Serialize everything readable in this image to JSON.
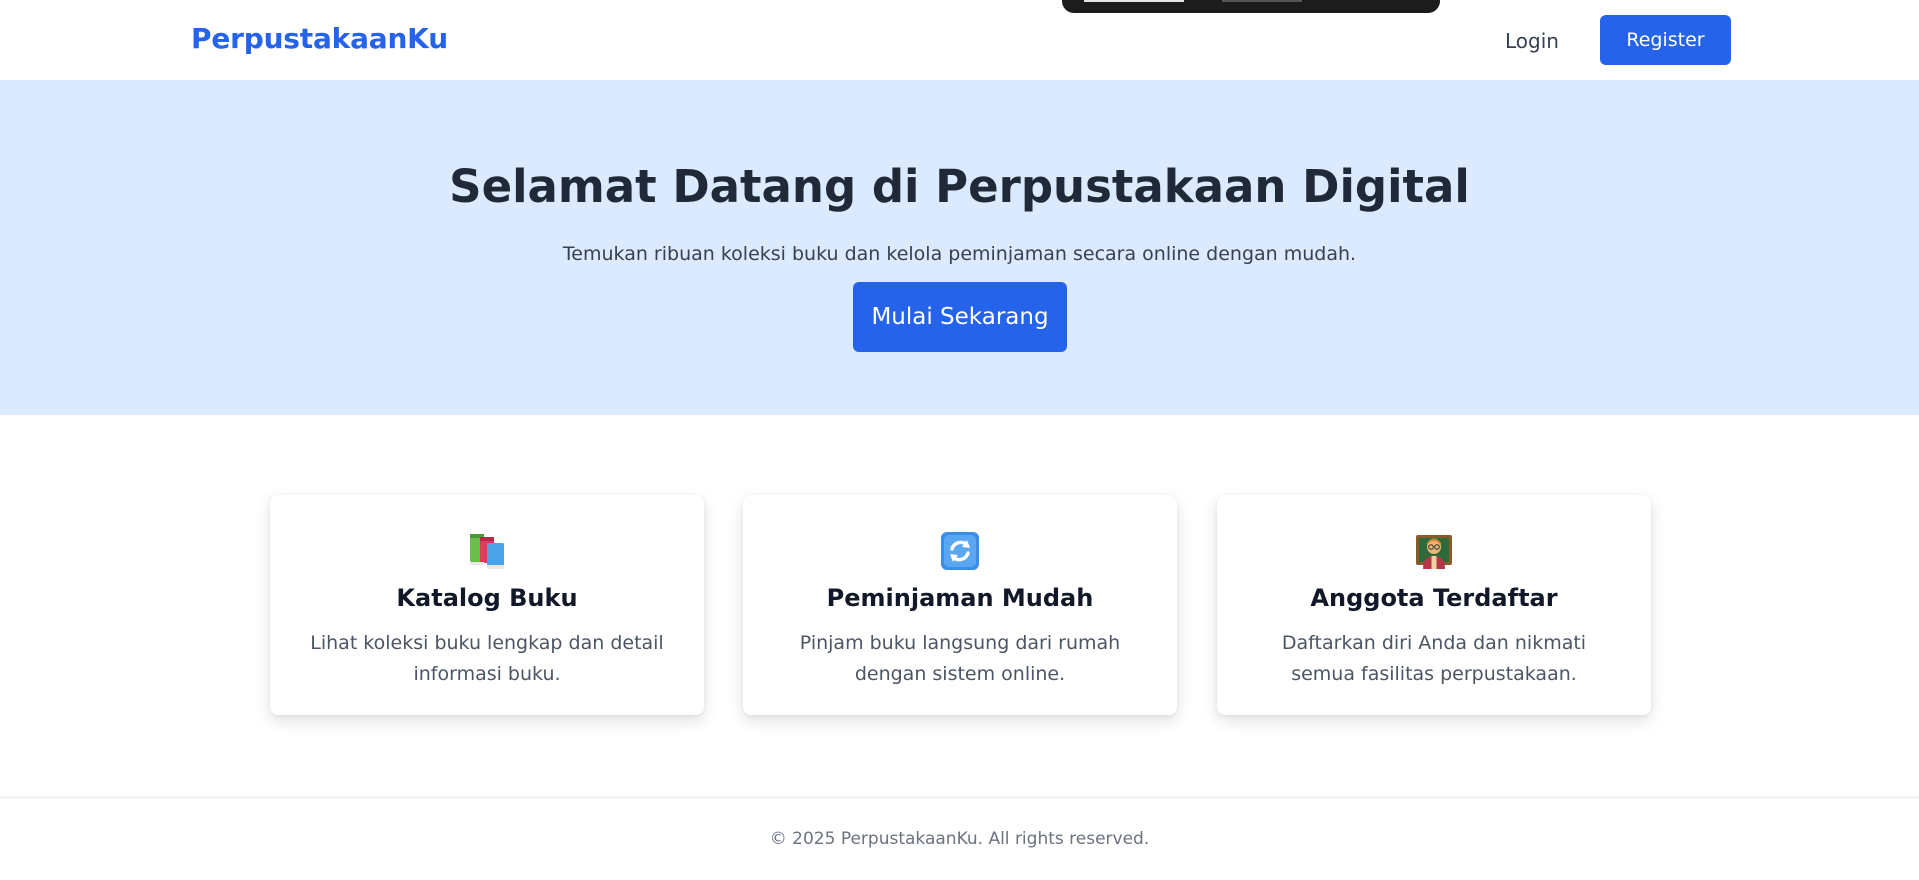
{
  "header": {
    "brand": "PerpustakaanKu",
    "login_label": "Login",
    "register_label": "Register"
  },
  "hero": {
    "title": "Selamat Datang di Perpustakaan Digital",
    "subtitle": "Temukan ribuan koleksi buku dan kelola peminjaman secara online dengan mudah.",
    "cta_label": "Mulai Sekarang"
  },
  "features": [
    {
      "icon": "books-icon",
      "title": "Katalog Buku",
      "text": "Lihat koleksi buku lengkap dan detail informasi buku."
    },
    {
      "icon": "refresh-icon",
      "title": "Peminjaman Mudah",
      "text": "Pinjam buku langsung dari rumah dengan sistem online."
    },
    {
      "icon": "teacher-icon",
      "title": "Anggota Terdaftar",
      "text": "Daftarkan diri Anda dan nikmati semua fasilitas perpustakaan."
    }
  ],
  "footer": {
    "text": "© 2025 PerpustakaanKu. All rights reserved."
  },
  "colors": {
    "accent": "#2563eb",
    "hero_bg": "#dbeafe",
    "text_dark": "#1f2937"
  }
}
